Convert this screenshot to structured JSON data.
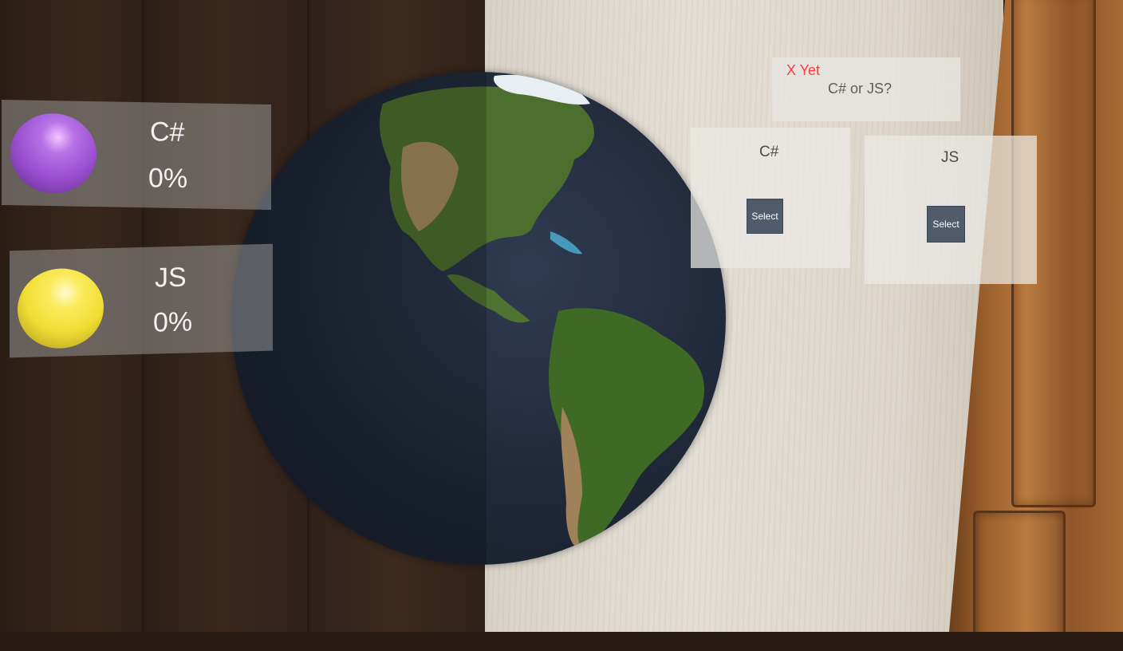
{
  "results": [
    {
      "label": "C#",
      "percent": "0%",
      "sphere_color": "#9b4fd1"
    },
    {
      "label": "JS",
      "percent": "0%",
      "sphere_color": "#f1dd34"
    }
  ],
  "question": {
    "status": "X Yet",
    "text": "C# or JS?"
  },
  "options": [
    {
      "label": "C#",
      "button": "Select"
    },
    {
      "label": "JS",
      "button": "Select"
    }
  ],
  "icons": {
    "globe": "earth-globe-icon",
    "sphere": "sphere-icon"
  }
}
